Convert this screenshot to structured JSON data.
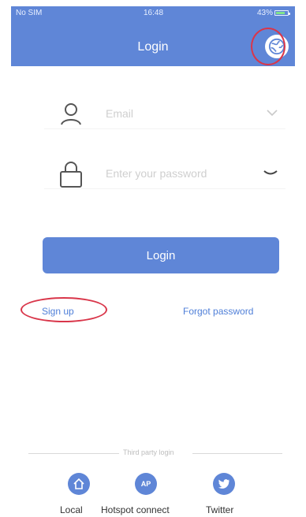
{
  "status_bar": {
    "carrier": "No SIM",
    "time": "16:48",
    "battery": "43%"
  },
  "nav": {
    "title": "Login",
    "language_icon": "globe-icon"
  },
  "form": {
    "email_placeholder": "Email",
    "password_placeholder": "Enter your password",
    "login_label": "Login"
  },
  "links": {
    "sign_up": "Sign up",
    "forgot_password": "Forgot password"
  },
  "third_party": {
    "title": "Third party login",
    "items": [
      {
        "label": "Local",
        "icon": "home-icon"
      },
      {
        "label": "Hotspot connect",
        "icon": "ap-icon",
        "icon_text": "AP"
      },
      {
        "label": "Twitter",
        "icon": "twitter-icon"
      }
    ]
  },
  "colors": {
    "primary": "#5f86d7",
    "link": "#4f7fd8",
    "highlight_ring": "#d9364a"
  }
}
